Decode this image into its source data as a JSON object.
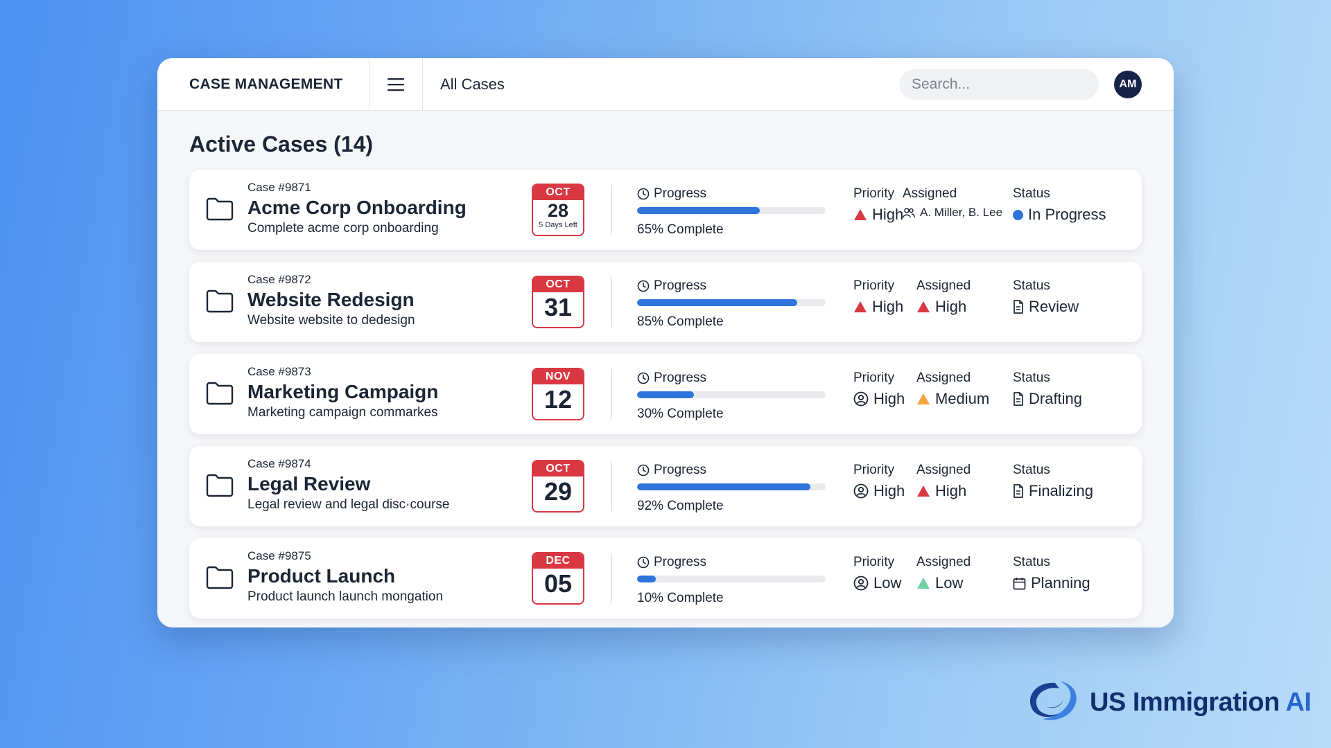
{
  "header": {
    "brand": "CASE MANAGEMENT",
    "nav_title": "All Cases",
    "search_placeholder": "Search...",
    "avatar_initials": "AM"
  },
  "page_title": "Active Cases (14)",
  "labels": {
    "progress": "Progress",
    "priority": "Priority",
    "assigned": "Assigned",
    "status": "Status"
  },
  "colors": {
    "accent_blue": "#2f74dc",
    "danger_red": "#d93842",
    "warning_orange": "#f5a33b",
    "low_green": "#6ed3a4"
  },
  "cases": [
    {
      "id": "Case #9871",
      "name": "Acme Corp Onboarding",
      "description": "Complete acme corp onboarding",
      "date_month": "OCT",
      "date_day": "28",
      "date_note": "5 Days Left",
      "progress": 65,
      "progress_text": "65% Complete",
      "priority": "High",
      "priority_icon": "red-triangle-icon",
      "assigned": "A. Miller, B. Lee",
      "assigned_icon": "users-icon",
      "status": "In Progress",
      "status_icon": "blue-dot-icon"
    },
    {
      "id": "Case #9872",
      "name": "Website Redesign",
      "description": "Website website to dedesign",
      "date_month": "OCT",
      "date_day": "31",
      "date_note": "",
      "progress": 85,
      "progress_text": "85% Complete",
      "priority": "High",
      "priority_icon": "red-triangle-icon",
      "assigned": "High",
      "assigned_icon": "red-triangle-icon",
      "status": "Review",
      "status_icon": "document-icon"
    },
    {
      "id": "Case #9873",
      "name": "Marketing Campaign",
      "description": "Marketing campaign commarkes",
      "date_month": "NOV",
      "date_day": "12",
      "date_note": "",
      "progress": 30,
      "progress_text": "30% Complete",
      "priority": "High",
      "priority_icon": "user-circle-icon",
      "assigned": "Medium",
      "assigned_icon": "orange-triangle-icon",
      "status": "Drafting",
      "status_icon": "document-icon"
    },
    {
      "id": "Case #9874",
      "name": "Legal Review",
      "description": "Legal review and legal disc·course",
      "date_month": "OCT",
      "date_day": "29",
      "date_note": "",
      "progress": 92,
      "progress_text": "92% Complete",
      "priority": "High",
      "priority_icon": "user-circle-icon",
      "assigned": "High",
      "assigned_icon": "red-triangle-icon",
      "status": "Finalizing",
      "status_icon": "document-icon"
    },
    {
      "id": "Case #9875",
      "name": "Product Launch",
      "description": "Product launch launch mongation",
      "date_month": "DEC",
      "date_day": "05",
      "date_note": "",
      "progress": 10,
      "progress_text": "10% Complete",
      "priority": "Low",
      "priority_icon": "user-circle-icon",
      "assigned": "Low",
      "assigned_icon": "green-triangle-icon",
      "status": "Planning",
      "status_icon": "calendar-icon"
    }
  ],
  "logo": {
    "text": "US Immigration",
    "suffix": "AI"
  }
}
